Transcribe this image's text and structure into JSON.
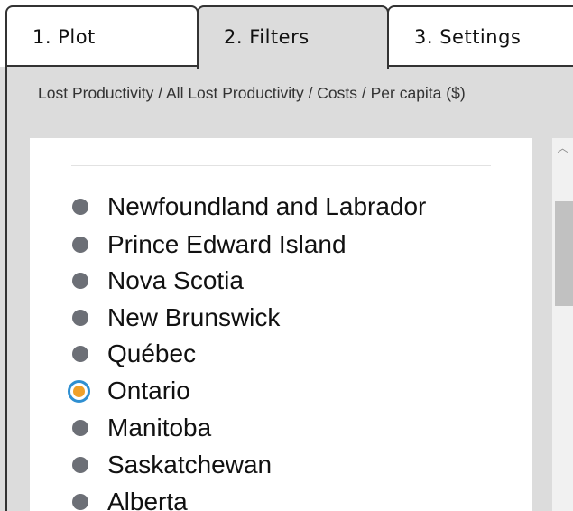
{
  "tabs": [
    {
      "label": "1. Plot"
    },
    {
      "label": "2. Filters"
    },
    {
      "label": "3. Settings"
    }
  ],
  "active_tab": "2. Filters",
  "breadcrumb": "Lost Productivity / All Lost Productivity / Costs / Per capita ($)",
  "regions": [
    {
      "label": "Newfoundland and Labrador",
      "selected": false
    },
    {
      "label": "Prince Edward Island",
      "selected": false
    },
    {
      "label": "Nova Scotia",
      "selected": false
    },
    {
      "label": "New Brunswick",
      "selected": false
    },
    {
      "label": "Québec",
      "selected": false
    },
    {
      "label": "Ontario",
      "selected": true
    },
    {
      "label": "Manitoba",
      "selected": false
    },
    {
      "label": "Saskatchewan",
      "selected": false
    },
    {
      "label": "Alberta",
      "selected": false
    }
  ],
  "icons": {
    "scroll_up": "chevron-up-icon",
    "option_bullet": "bullet-dot-icon",
    "option_selected": "radio-selected-icon"
  },
  "colors": {
    "panel_background": "#dcdcdc",
    "bullet": "#6c6f76",
    "radio_ring": "#2f8fd1",
    "radio_fill": "#f0a02a"
  }
}
